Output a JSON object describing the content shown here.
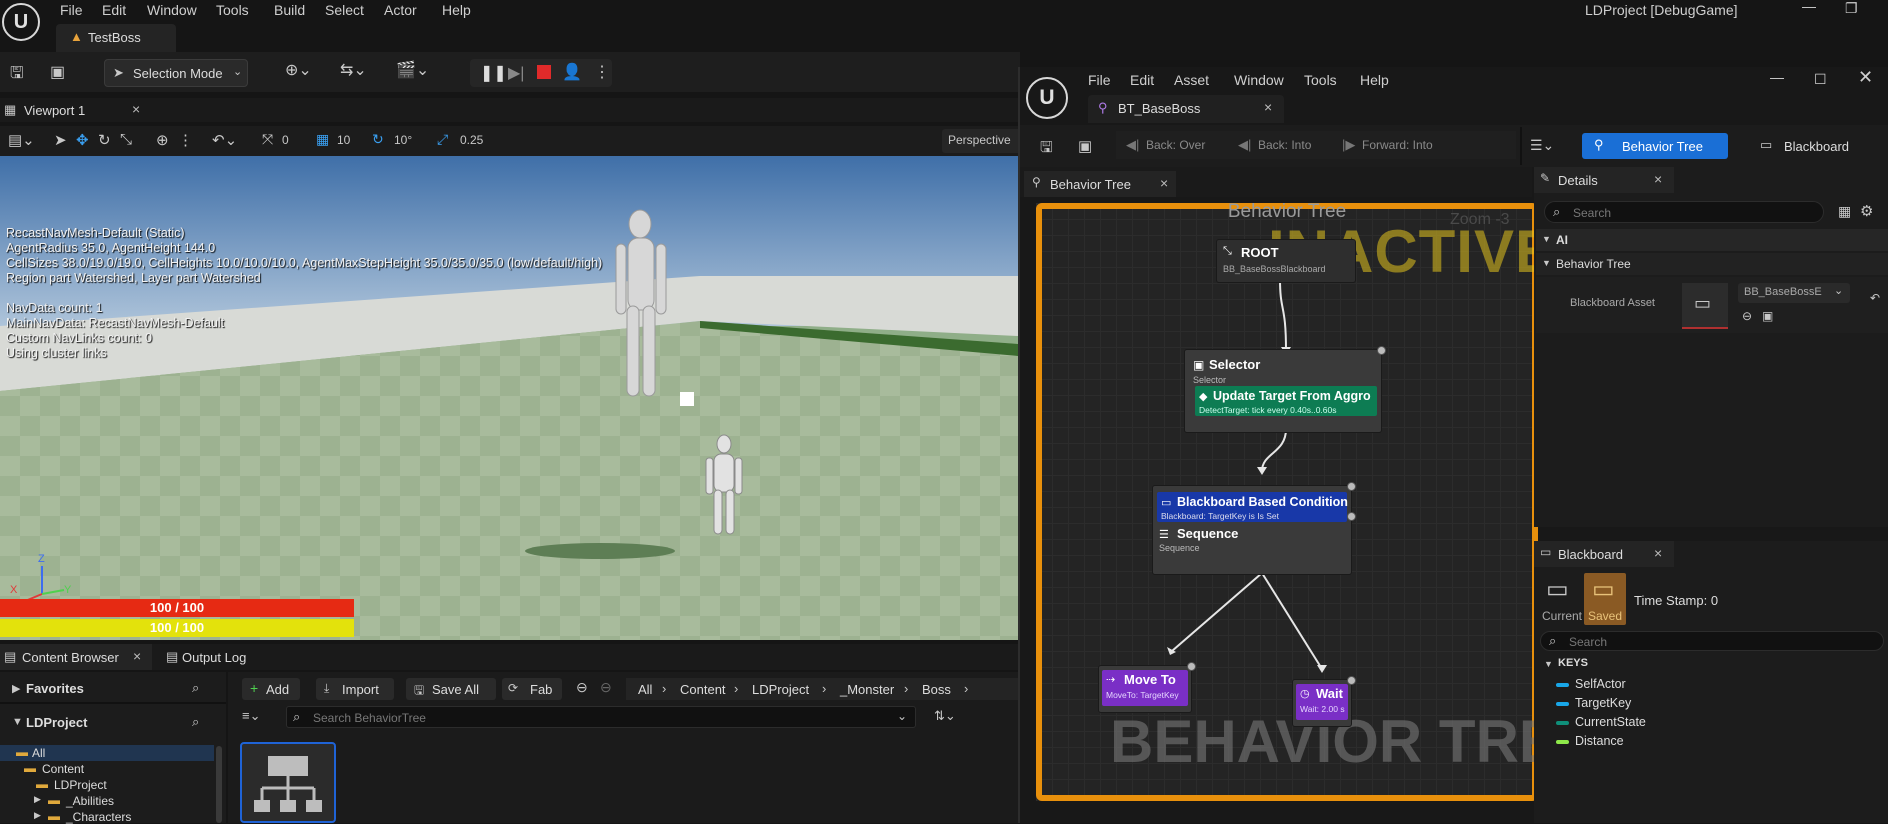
{
  "main": {
    "menu": [
      "File",
      "Edit",
      "Window",
      "Tools",
      "Build",
      "Select",
      "Actor",
      "Help"
    ],
    "window_title": "LDProject [DebugGame]",
    "tab": "TestBoss",
    "selection_mode": "Selection Mode",
    "viewport_tab": "Viewport 1",
    "viewport_toolbar": {
      "rotate_snap": "0",
      "grid_snap": "10",
      "angle_snap": "10°",
      "scale_snap": "0.25",
      "perspective": "Perspective"
    },
    "navmesh_info": [
      "RecastNavMesh-Default (Static)",
      "AgentRadius 35.0, AgentHeight 144.0",
      "CellSizes 38.0/19.0/19.0, CellHeights 10.0/10.0/10.0, AgentMaxStepHeight 35.0/35.0/35.0 (low/default/high)",
      "Region part Watershed, Layer part Watershed",
      "",
      "NavData count: 1",
      "MainNavData: RecastNavMesh-Default",
      "Custom NavLinks count: 0",
      "Using cluster links"
    ],
    "axes": {
      "x": "X",
      "y": "Y",
      "z": "Z"
    },
    "health_bar": "100 / 100",
    "stamina_bar": "100 / 100",
    "bottom_tabs": {
      "content_browser": "Content Browser",
      "output_log": "Output Log"
    },
    "content_browser": {
      "favorites": "Favorites",
      "project": "LDProject",
      "tree": [
        "All",
        "Content",
        "LDProject",
        "_Abilities",
        "_Characters"
      ],
      "add": "Add",
      "import": "Import",
      "save_all": "Save All",
      "fab": "Fab",
      "path": [
        "All",
        "Content",
        "LDProject",
        "_Monster",
        "Boss"
      ],
      "search_placeholder": "Search BehaviorTree"
    }
  },
  "bt": {
    "menu": [
      "File",
      "Edit",
      "Asset",
      "Window",
      "Tools",
      "Help"
    ],
    "doc_tab": "BT_BaseBoss",
    "toolbar": {
      "back_over": "Back: Over",
      "back_into": "Back: Into",
      "forward_into": "Forward: Into",
      "behavior_tree": "Behavior Tree",
      "blackboard": "Blackboard"
    },
    "graph_tab": "Behavior Tree",
    "graph": {
      "title": "Behavior Tree",
      "zoom": "Zoom -3",
      "status": "INACTIVE",
      "watermark": "BEHAVIOR TREE",
      "root": {
        "label": "ROOT",
        "sub": "BB_BaseBossBlackboard"
      },
      "selector": {
        "label": "Selector",
        "sub": "Selector"
      },
      "service": {
        "label": "Update Target From Aggro",
        "sub": "DetectTarget: tick every 0.40s..0.60s"
      },
      "decorator": {
        "label": "Blackboard Based Condition",
        "sub": "Blackboard: TargetKey is Is Set"
      },
      "sequence": {
        "label": "Sequence",
        "sub": "Sequence"
      },
      "moveto": {
        "label": "Move To",
        "sub": "MoveTo: TargetKey"
      },
      "wait": {
        "label": "Wait",
        "sub": "Wait: 2.00 s"
      }
    },
    "details": {
      "title": "Details",
      "search": "Search",
      "section_ai": "AI",
      "section_bt": "Behavior Tree",
      "blackboard_asset": "Blackboard Asset",
      "asset_value": "BB_BaseBossE"
    },
    "blackboard": {
      "title": "Blackboard",
      "current": "Current",
      "saved": "Saved",
      "timestamp": "Time Stamp: 0",
      "search": "Search",
      "keys_header": "KEYS",
      "keys": [
        {
          "name": "SelfActor",
          "color": "#19a7e8"
        },
        {
          "name": "TargetKey",
          "color": "#19a7e8"
        },
        {
          "name": "CurrentState",
          "color": "#0f8f7a"
        },
        {
          "name": "Distance",
          "color": "#8ee84a"
        }
      ]
    }
  }
}
